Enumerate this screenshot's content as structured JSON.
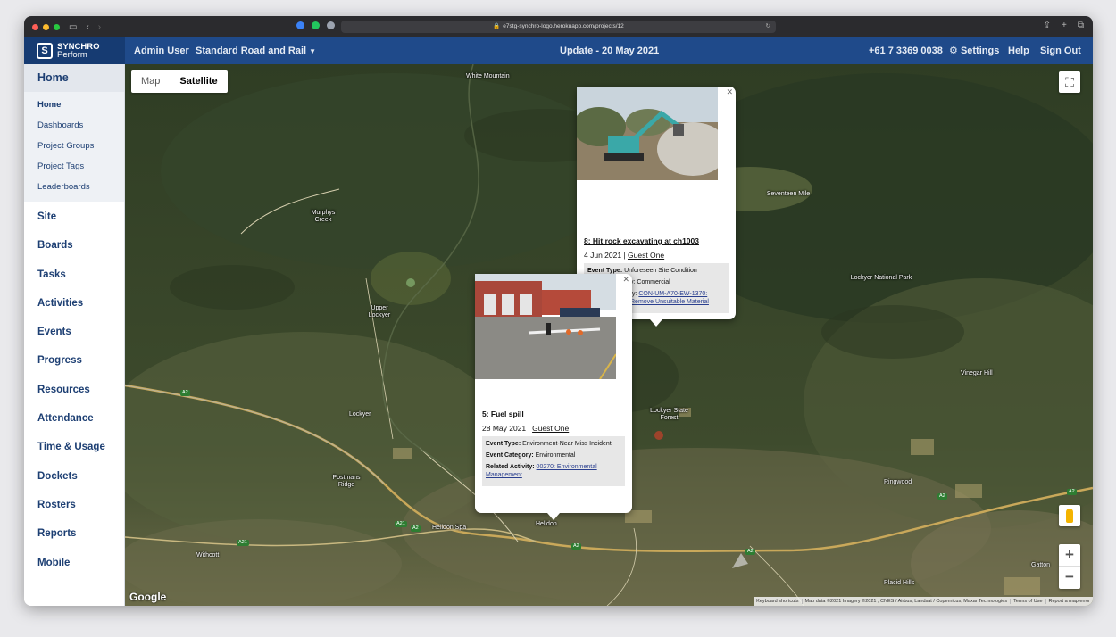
{
  "browser": {
    "url": "e7stg-synchro-logo.herokuapp.com/projects/12"
  },
  "navbar": {
    "brand_line1": "SYNCHRO",
    "brand_line2": "Perform",
    "user": "Admin User",
    "project": "Standard Road and Rail",
    "update": "Update - 20 May 2021",
    "phone": "+61 7 3369 0038",
    "settings": "Settings",
    "help": "Help",
    "sign_out": "Sign Out"
  },
  "sidebar": {
    "header": "Home",
    "sub_items": [
      "Home",
      "Dashboards",
      "Project Groups",
      "Project Tags",
      "Leaderboards"
    ],
    "items": [
      "Site",
      "Boards",
      "Tasks",
      "Activities",
      "Events",
      "Progress",
      "Resources",
      "Attendance",
      "Time & Usage",
      "Dockets",
      "Rosters",
      "Reports",
      "Mobile"
    ]
  },
  "map": {
    "toggle_map": "Map",
    "toggle_satellite": "Satellite",
    "google": "Google",
    "zoom_in": "+",
    "zoom_out": "−",
    "attribution": [
      "Keyboard shortcuts",
      "Map data ©2021 Imagery ©2021 , CNES / Airbus, Landsat / Copernicus, Maxar Technologies",
      "Terms of Use",
      "Report a map error"
    ],
    "places": [
      "White Mountain",
      "Seventeen Mile",
      "Murphys Creek",
      "Upper Lockyer",
      "Lockyer National Park",
      "Lockyer",
      "Lockyer State Forest",
      "Vinegar Hill",
      "Postmans Ridge",
      "Helidon Spa",
      "Helidon",
      "Ringwood",
      "Withcott",
      "Placid Hills",
      "Gatton"
    ],
    "shields": [
      "A2",
      "A21",
      "A2",
      "A21",
      "A2",
      "A2",
      "A2",
      "A2"
    ]
  },
  "popup1": {
    "title": "8: Hit rock excavating at ch1003",
    "date": "4 Jun 2021",
    "author": "Guest One",
    "event_type_label": "Event Type:",
    "event_type": "Unforeseen Site Condition",
    "category_tail": "y: Commercial",
    "activity_tail": "ty:",
    "activity_link1": "CON-UM-A70-EW-1370:",
    "activity_link2": "Remove Unsuitable Material"
  },
  "popup2": {
    "title": "5: Fuel spill",
    "date": "28 May 2021",
    "author": "Guest One",
    "event_type_label": "Event Type:",
    "event_type": "Environment-Near Miss Incident",
    "category_label": "Event Category:",
    "category": "Environmental",
    "activity_label": "Related Activity:",
    "activity_link": "00270: Environmental Management"
  },
  "colors": {
    "navbar": "#1f4a8a",
    "brand_bg": "#163b72",
    "sidebar_text": "#1d3f73"
  }
}
